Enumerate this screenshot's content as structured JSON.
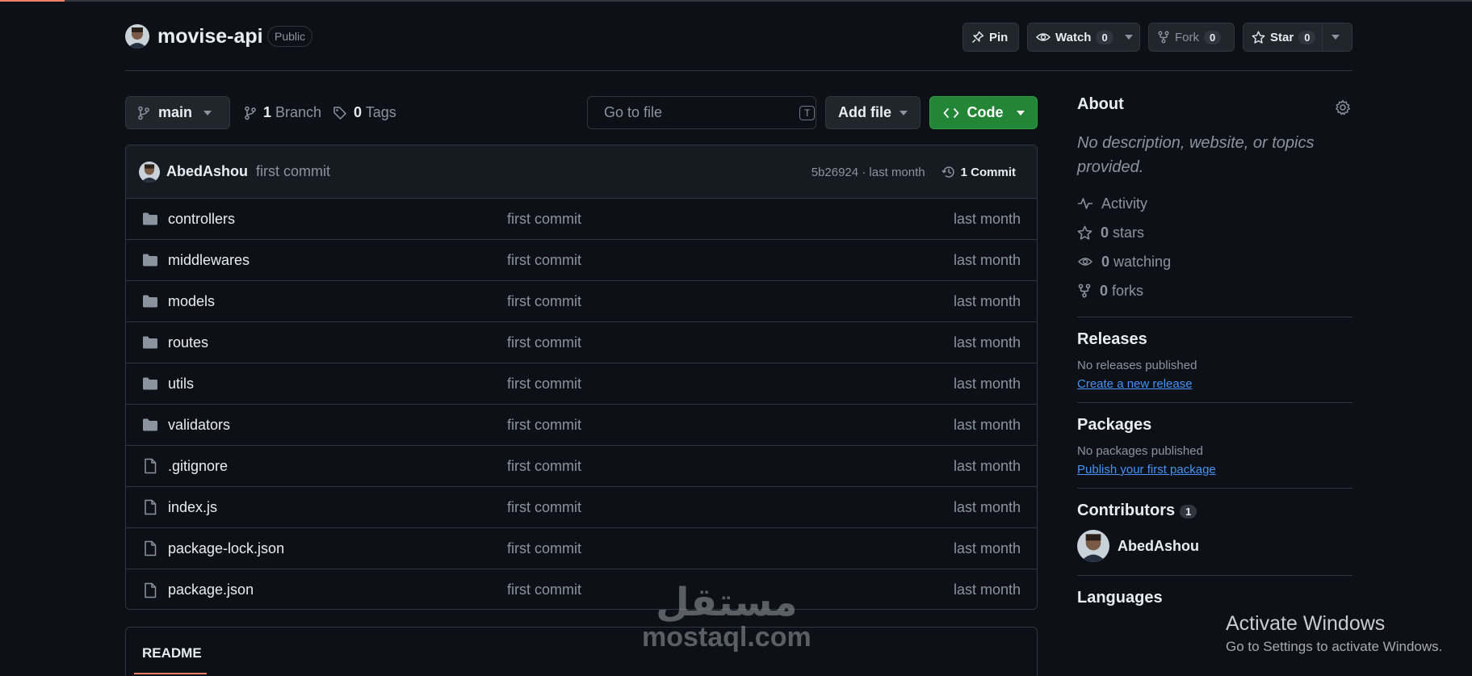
{
  "repo": {
    "name": "movise-api",
    "visibility": "Public"
  },
  "header_actions": {
    "pin": "Pin",
    "watch": "Watch",
    "watch_count": "0",
    "fork": "Fork",
    "fork_count": "0",
    "star": "Star",
    "star_count": "0"
  },
  "toolbar": {
    "branch": "main",
    "branch_count": "1",
    "branch_label": "Branch",
    "tag_count": "0",
    "tag_label": "Tags",
    "goto_placeholder": "Go to file",
    "goto_shortcut": "T",
    "add_file": "Add file",
    "code": "Code"
  },
  "latest_commit": {
    "author": "AbedAshou",
    "message": "first commit",
    "hash_time": "5b26924 · last month",
    "commits_count": "1",
    "commits_label": "Commit"
  },
  "files": [
    {
      "name": "controllers",
      "type": "folder",
      "message": "first commit",
      "time": "last month"
    },
    {
      "name": "middlewares",
      "type": "folder",
      "message": "first commit",
      "time": "last month"
    },
    {
      "name": "models",
      "type": "folder",
      "message": "first commit",
      "time": "last month"
    },
    {
      "name": "routes",
      "type": "folder",
      "message": "first commit",
      "time": "last month"
    },
    {
      "name": "utils",
      "type": "folder",
      "message": "first commit",
      "time": "last month"
    },
    {
      "name": "validators",
      "type": "folder",
      "message": "first commit",
      "time": "last month"
    },
    {
      "name": ".gitignore",
      "type": "file",
      "message": "first commit",
      "time": "last month"
    },
    {
      "name": "index.js",
      "type": "file",
      "message": "first commit",
      "time": "last month"
    },
    {
      "name": "package-lock.json",
      "type": "file",
      "message": "first commit",
      "time": "last month"
    },
    {
      "name": "package.json",
      "type": "file",
      "message": "first commit",
      "time": "last month"
    }
  ],
  "readme_tab": "README",
  "sidebar": {
    "about_title": "About",
    "about_desc": "No description, website, or topics provided.",
    "activity": "Activity",
    "stars_count": "0",
    "stars_label": "stars",
    "watching_count": "0",
    "watching_label": "watching",
    "forks_count": "0",
    "forks_label": "forks",
    "releases_title": "Releases",
    "releases_empty": "No releases published",
    "releases_link": "Create a new release",
    "packages_title": "Packages",
    "packages_empty": "No packages published",
    "packages_link": "Publish your first package",
    "contributors_title": "Contributors",
    "contributors_count": "1",
    "contributor_name": "AbedAshou",
    "languages_title": "Languages"
  },
  "overlay": {
    "activate_title": "Activate Windows",
    "activate_sub": "Go to Settings to activate Windows.",
    "watermark_arabic": "مستقل",
    "watermark_latin": "mostaql.com"
  },
  "colors": {
    "background": "#0d1117",
    "border": "#30363d",
    "code_button": "#238636",
    "link": "#4493f8",
    "accent": "#f78166"
  }
}
